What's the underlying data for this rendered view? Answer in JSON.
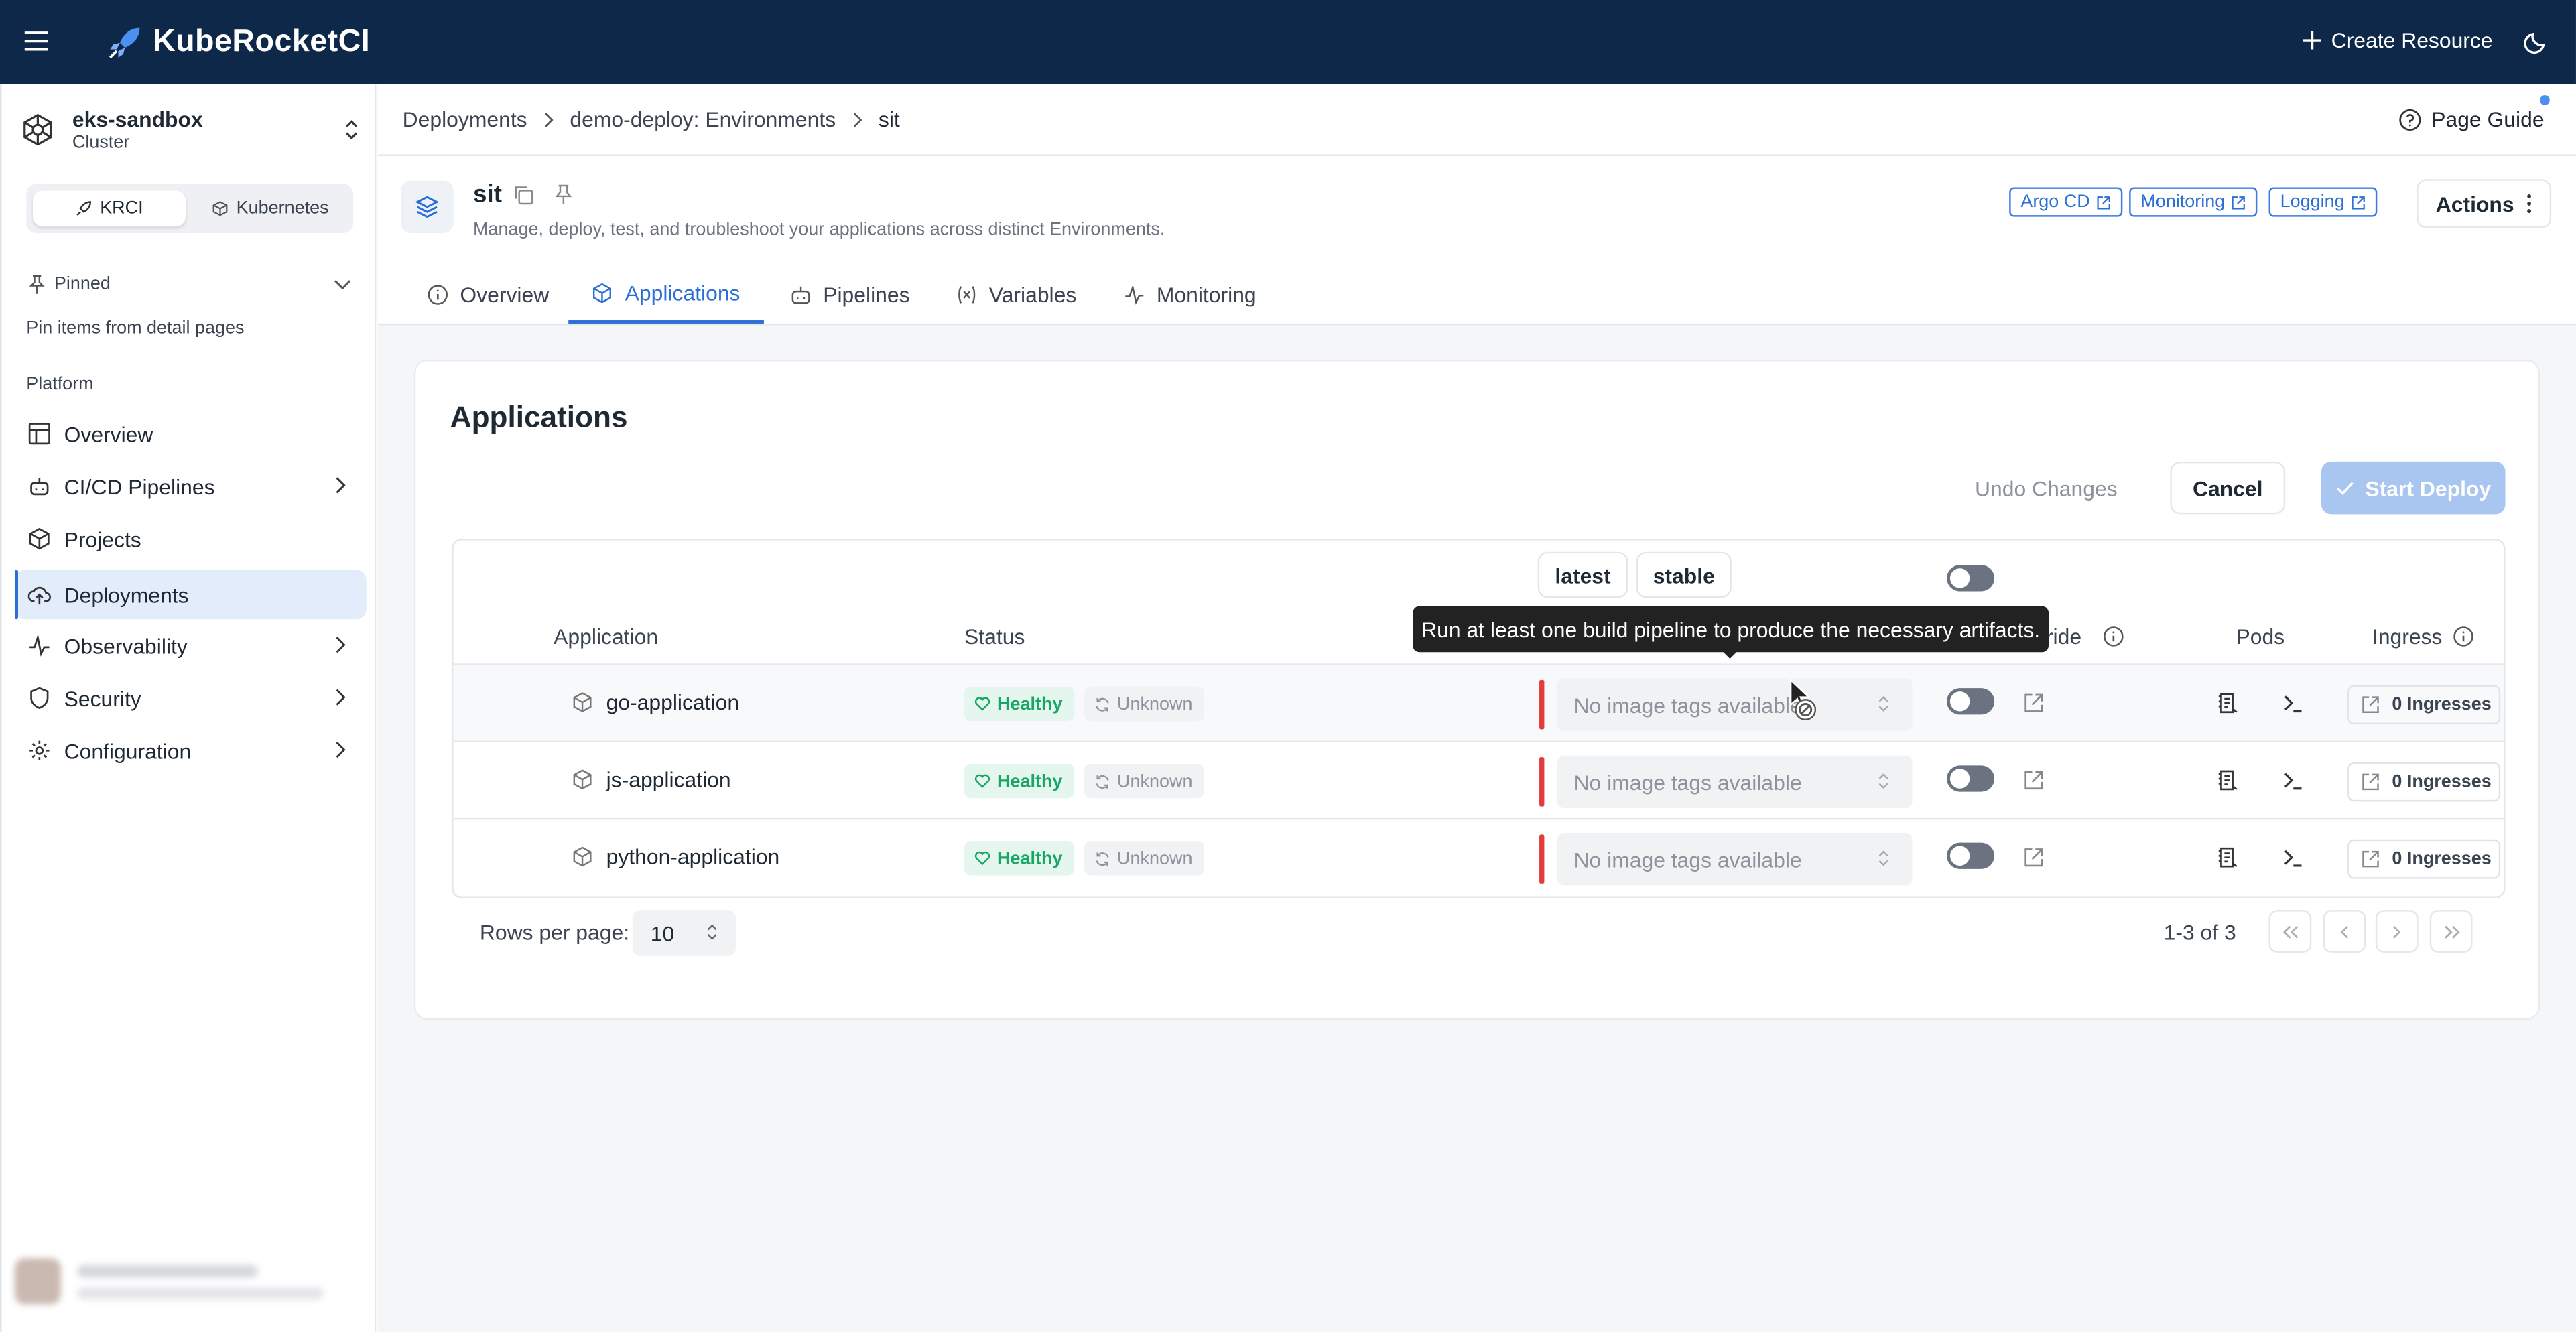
{
  "topbar": {
    "app_name": "KubeRocketCI",
    "create_resource": "Create Resource",
    "icons": [
      "menu-icon",
      "rocket-logo-icon",
      "plus-icon",
      "moon-icon"
    ]
  },
  "sidebar": {
    "cluster_name": "eks-sandbox",
    "cluster_type": "Cluster",
    "mode_tabs": [
      {
        "label": "KRCI",
        "active": true
      },
      {
        "label": "Kubernetes",
        "active": false
      }
    ],
    "pinned_label": "Pinned",
    "pinned_hint": "Pin items from detail pages",
    "platform_label": "Platform",
    "items": [
      {
        "label": "Overview",
        "icon": "table-icon"
      },
      {
        "label": "CI/CD Pipelines",
        "icon": "robot-icon"
      },
      {
        "label": "Projects",
        "icon": "cube-icon"
      },
      {
        "label": "Deployments",
        "icon": "cloud-upload-icon",
        "active": true
      },
      {
        "label": "Observability",
        "icon": "pulse-icon"
      },
      {
        "label": "Security",
        "icon": "shield-icon"
      },
      {
        "label": "Configuration",
        "icon": "gear-icon"
      }
    ]
  },
  "breadcrumb": [
    "Deployments",
    "demo-deploy: Environments",
    "sit"
  ],
  "page_guide": "Page Guide",
  "page": {
    "title": "sit",
    "description": "Manage, deploy, test, and troubleshoot your applications across distinct Environments.",
    "links": [
      "Argo CD",
      "Monitoring",
      "Logging"
    ],
    "actions": "Actions"
  },
  "tabs": [
    {
      "label": "Overview",
      "icon": "info-icon"
    },
    {
      "label": "Applications",
      "icon": "cube-icon",
      "active": true
    },
    {
      "label": "Pipelines",
      "icon": "robot-icon"
    },
    {
      "label": "Variables",
      "icon": "variable-icon"
    },
    {
      "label": "Monitoring",
      "icon": "pulse-icon"
    }
  ],
  "applications": {
    "title": "Applications",
    "undo": "Undo Changes",
    "cancel": "Cancel",
    "start_deploy": "Start Deploy",
    "tag_buttons": [
      "latest",
      "stable"
    ],
    "columns": {
      "application": "Application",
      "status": "Status",
      "override_partial": "rride",
      "pods": "Pods",
      "ingress": "Ingress"
    },
    "rows": [
      {
        "name": "go-application",
        "health": "Healthy",
        "sync": "Unknown",
        "image_tag": "No image tags available",
        "ingresses": "0 Ingresses"
      },
      {
        "name": "js-application",
        "health": "Healthy",
        "sync": "Unknown",
        "image_tag": "No image tags available",
        "ingresses": "0 Ingresses"
      },
      {
        "name": "python-application",
        "health": "Healthy",
        "sync": "Unknown",
        "image_tag": "No image tags available",
        "ingresses": "0 Ingresses"
      }
    ],
    "rows_per_page_label": "Rows per page:",
    "rows_per_page": "10",
    "range": "1-3 of 3"
  },
  "tooltip": "Run at least one build pipeline to produce the necessary artifacts.",
  "colors": {
    "topbar": "#0d2848",
    "accent": "#2b6fd6",
    "healthy": "#17a664",
    "error_bar": "#e23c3c",
    "deploy_disabled": "#a9c6f1"
  }
}
